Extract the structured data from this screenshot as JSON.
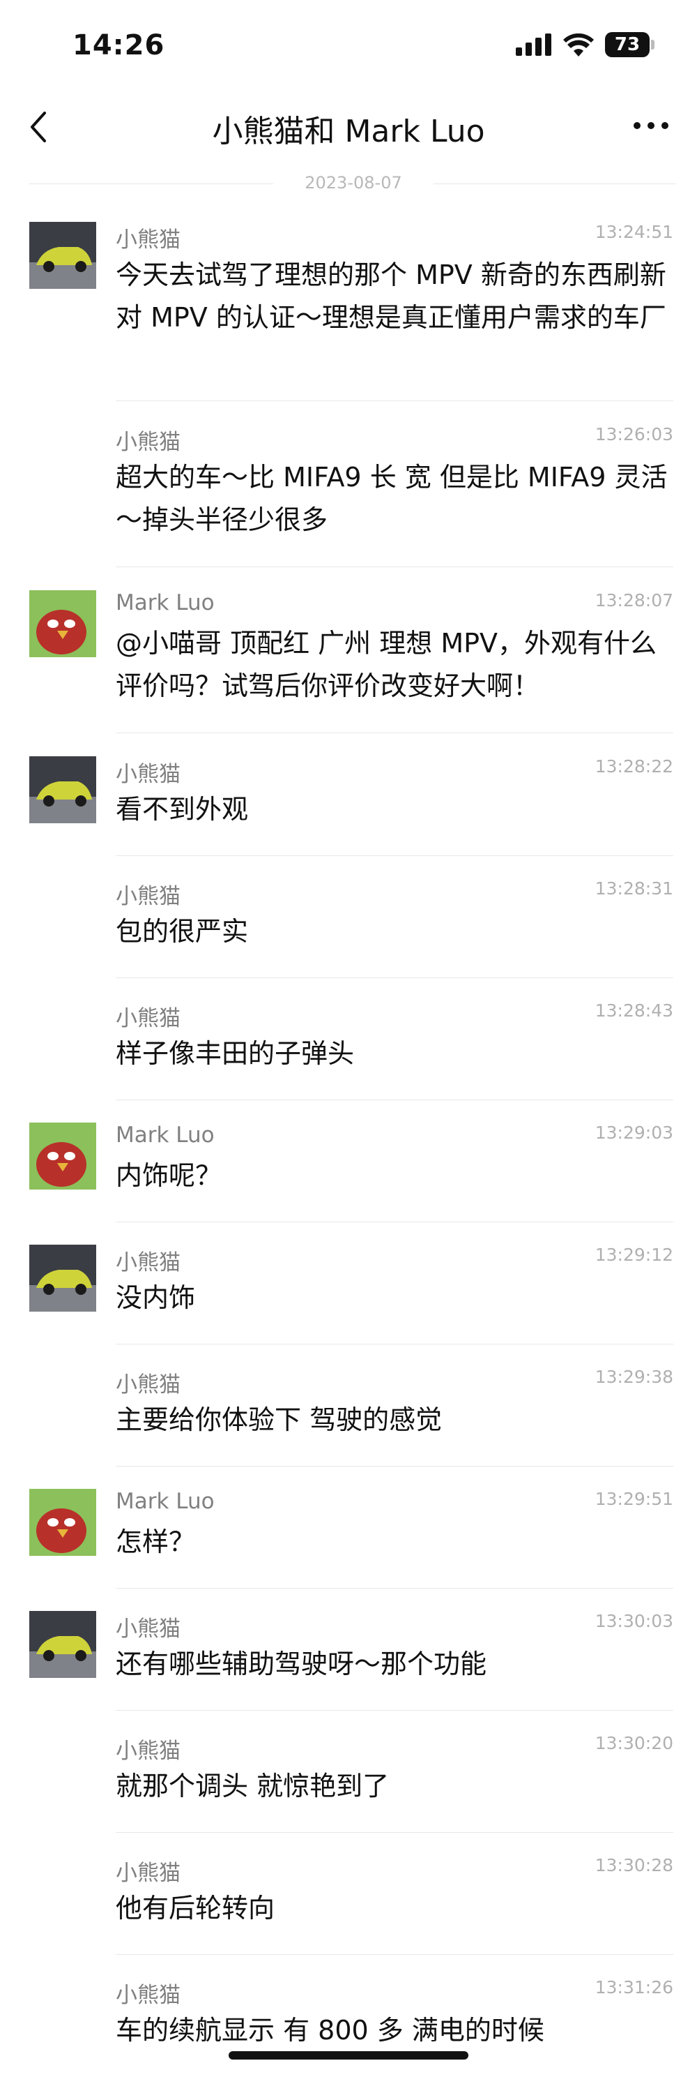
{
  "status_bar": {
    "time": "14:26",
    "battery": "73"
  },
  "header": {
    "title": "小熊猫和 Mark Luo"
  },
  "date_divider": "2023-08-07",
  "messages": [
    {
      "sender": "小熊猫",
      "time": "13:24:51",
      "text": "今天去试驾了理想的那个 MPV 新奇的东西刷新对 MPV 的认证～理想是真正懂用户需求的车厂",
      "avatar": "car-avatar"
    },
    {
      "sender": "小熊猫",
      "time": "13:26:03",
      "text": "超大的车～比 MIFA9 长 宽   但是比 MIFA9 灵活～掉头半径少很多",
      "avatar": ""
    },
    {
      "sender": "Mark Luo",
      "time": "13:28:07",
      "text": "@小喵哥 顶配红 广州 理想 MPV，外观有什么评价吗？试驾后你评价改变好大啊！",
      "avatar": "bird-avatar"
    },
    {
      "sender": "小熊猫",
      "time": "13:28:22",
      "text": "看不到外观",
      "avatar": "car-avatar"
    },
    {
      "sender": "小熊猫",
      "time": "13:28:31",
      "text": "包的很严实",
      "avatar": ""
    },
    {
      "sender": "小熊猫",
      "time": "13:28:43",
      "text": "样子像丰田的子弹头",
      "avatar": ""
    },
    {
      "sender": "Mark Luo",
      "time": "13:29:03",
      "text": "内饰呢？",
      "avatar": "bird-avatar"
    },
    {
      "sender": "小熊猫",
      "time": "13:29:12",
      "text": "没内饰",
      "avatar": "car-avatar"
    },
    {
      "sender": "小熊猫",
      "time": "13:29:38",
      "text": "主要给你体验下 驾驶的感觉",
      "avatar": ""
    },
    {
      "sender": "Mark Luo",
      "time": "13:29:51",
      "text": "怎样？",
      "avatar": "bird-avatar"
    },
    {
      "sender": "小熊猫",
      "time": "13:30:03",
      "text": "还有哪些辅助驾驶呀～那个功能",
      "avatar": "car-avatar"
    },
    {
      "sender": "小熊猫",
      "time": "13:30:20",
      "text": "就那个调头 就惊艳到了",
      "avatar": ""
    },
    {
      "sender": "小熊猫",
      "time": "13:30:28",
      "text": "他有后轮转向",
      "avatar": ""
    },
    {
      "sender": "小熊猫",
      "time": "13:31:26",
      "text": "车的续航显示 有 800 多 满电的时候",
      "avatar": ""
    }
  ]
}
